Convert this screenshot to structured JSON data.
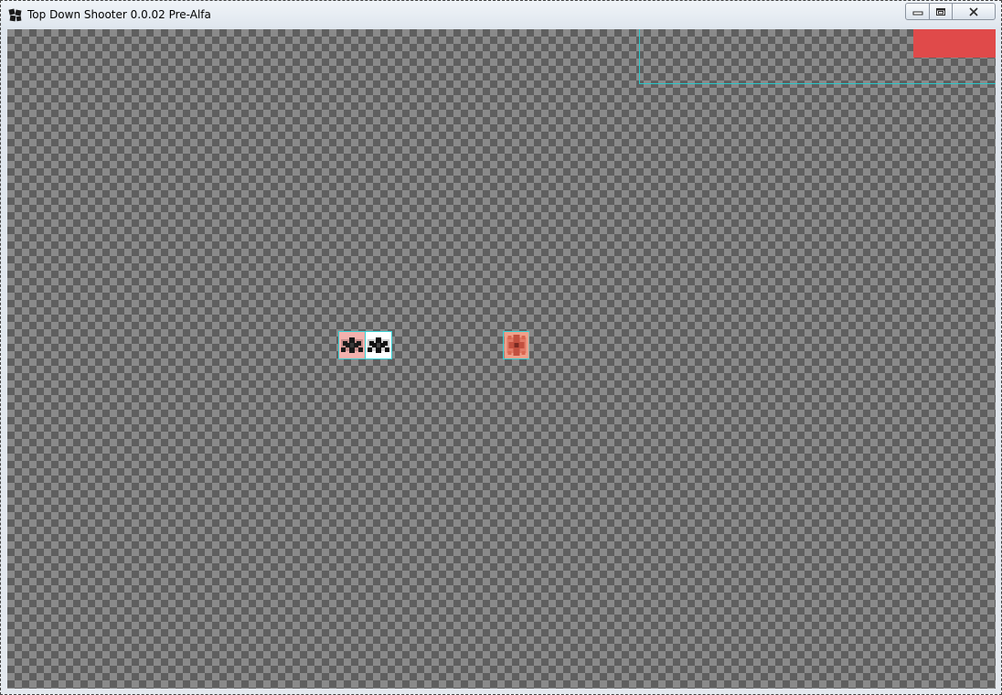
{
  "window": {
    "title": "Top Down Shooter 0.0.02 Pre-Alfa",
    "icons": {
      "app": "app-icon",
      "minimize": "minimize-icon",
      "maximize": "maximize-icon",
      "close": "close-icon"
    }
  },
  "game": {
    "background": "transparency-checkerboard",
    "hud": {
      "health_bar_color": "#e04a4a",
      "frame_color": "#2ac7c9"
    },
    "sprites": [
      {
        "name": "player",
        "tint": "#f3b1ad"
      },
      {
        "name": "companion",
        "tint": "#ffffff"
      },
      {
        "name": "enemy",
        "tint": "#f0a08a"
      }
    ]
  },
  "colors": {
    "accent": "#2ac7c9",
    "danger": "#e04a4a"
  }
}
